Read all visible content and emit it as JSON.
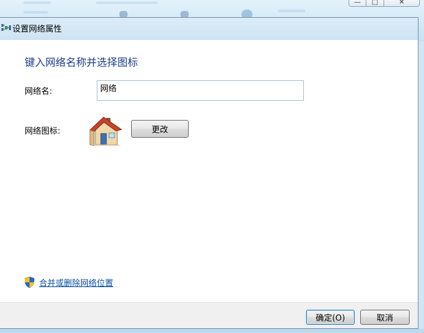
{
  "window": {
    "title": "设置网络属性",
    "title_icon": "network-icon"
  },
  "main": {
    "heading": "键入网络名称并选择图标",
    "name_label": "网络名:",
    "name_value": "网络",
    "icon_label": "网络图标:",
    "network_icon": "house-icon",
    "change_button": "更改",
    "merge_link": "合并或删除网络位置",
    "merge_link_icon": "shield-icon"
  },
  "footer": {
    "ok_button": "确定(O)",
    "cancel_button": "取消"
  },
  "colors": {
    "heading": "#1e3f86",
    "link": "#0a4fa0",
    "titlebar": "#cfe4f4",
    "footer": "#f0f0f0"
  }
}
